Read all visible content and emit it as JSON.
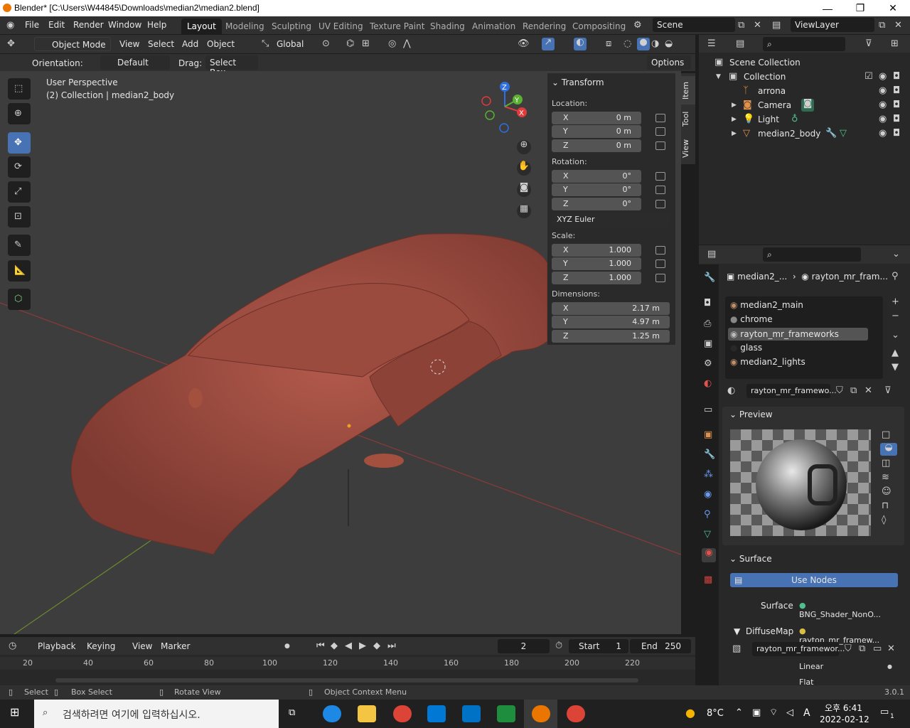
{
  "window": {
    "title": "Blender* [C:\\Users\\W44845\\Downloads\\median2\\median2.blend]",
    "min": "—",
    "max": "❐",
    "close": "✕"
  },
  "menu": [
    "File",
    "Edit",
    "Render",
    "Window",
    "Help"
  ],
  "workspaces": [
    "Layout",
    "Modeling",
    "Sculpting",
    "UV Editing",
    "Texture Paint",
    "Shading",
    "Animation",
    "Rendering",
    "Compositing"
  ],
  "scene": "Scene",
  "view_layer": "ViewLayer",
  "viewport_header": {
    "mode": "Object Mode",
    "view": "View",
    "select": "Select",
    "add": "Add",
    "object": "Object",
    "transform": "Global"
  },
  "tool_header": {
    "orientation_label": "Orientation:",
    "orientation": "Default",
    "drag_label": "Drag:",
    "drag": "Select Box",
    "options": "Options"
  },
  "viewport_info": {
    "line1": "User Perspective",
    "line2": "(2) Collection | median2_body"
  },
  "npanel": {
    "tabs": [
      "Item",
      "Tool",
      "View"
    ],
    "section": "Transform",
    "location_label": "Location:",
    "location": [
      {
        "axis": "X",
        "value": "0 m"
      },
      {
        "axis": "Y",
        "value": "0 m"
      },
      {
        "axis": "Z",
        "value": "0 m"
      }
    ],
    "rotation_label": "Rotation:",
    "rotation": [
      {
        "axis": "X",
        "value": "0°"
      },
      {
        "axis": "Y",
        "value": "0°"
      },
      {
        "axis": "Z",
        "value": "0°"
      }
    ],
    "rotation_mode": "XYZ Euler",
    "scale_label": "Scale:",
    "scale": [
      {
        "axis": "X",
        "value": "1.000"
      },
      {
        "axis": "Y",
        "value": "1.000"
      },
      {
        "axis": "Z",
        "value": "1.000"
      }
    ],
    "dimensions_label": "Dimensions:",
    "dimensions": [
      {
        "axis": "X",
        "value": "2.17 m"
      },
      {
        "axis": "Y",
        "value": "4.97 m"
      },
      {
        "axis": "Z",
        "value": "1.25 m"
      }
    ]
  },
  "outliner": {
    "root": "Scene Collection",
    "collection": "Collection",
    "items": [
      "arrona",
      "Camera",
      "Light",
      "median2_body"
    ]
  },
  "properties": {
    "breadcrumb_object": "median2_...",
    "breadcrumb_material": "rayton_mr_fram...",
    "slots": [
      "median2_main",
      "chrome",
      "rayton_mr_frameworks",
      "glass",
      "median2_lights"
    ],
    "material_name": "rayton_mr_framewo...",
    "preview_label": "Preview",
    "surface_section": "Surface",
    "use_nodes": "Use Nodes",
    "surface_label": "Surface",
    "surface_value": "BNG_Shader_NonO...",
    "diffusemap_label": "DiffuseMap",
    "diffusemap_value": "rayton_mr_framew...",
    "image_name": "rayton_mr_framewor...",
    "interp": "Linear",
    "proj": "Flat"
  },
  "timeline": {
    "playback": "Playback",
    "keying": "Keying",
    "view": "View",
    "marker": "Marker",
    "current_frame": "2",
    "start_label": "Start",
    "start": "1",
    "end_label": "End",
    "end": "250",
    "ruler": [
      "20",
      "40",
      "60",
      "80",
      "100",
      "120",
      "140",
      "160",
      "180",
      "200",
      "220"
    ]
  },
  "status": {
    "select": "Select",
    "box_select": "Box Select",
    "rotate_view": "Rotate View",
    "context_menu": "Object Context Menu",
    "version": "3.0.1"
  },
  "taskbar": {
    "search_placeholder": "검색하려면 여기에 입력하십시오.",
    "temp": "8°C",
    "ime": "A",
    "time": "오후 6:41",
    "date": "2022-02-12",
    "notif": "1"
  }
}
